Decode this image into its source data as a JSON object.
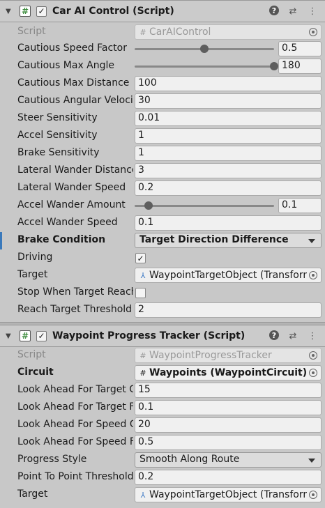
{
  "car_ai": {
    "title": "Car AI Control (Script)",
    "script_label": "Script",
    "script_value": "CarAIControl",
    "rows": [
      {
        "label": "Cautious Speed Factor",
        "value": "0.5",
        "slider": 0.5
      },
      {
        "label": "Cautious Max Angle",
        "value": "180",
        "slider": 1.0
      },
      {
        "label": "Cautious Max Distance",
        "value": "100"
      },
      {
        "label": "Cautious Angular Velocity Factor",
        "value": "30"
      },
      {
        "label": "Steer Sensitivity",
        "value": "0.01"
      },
      {
        "label": "Accel Sensitivity",
        "value": "1"
      },
      {
        "label": "Brake Sensitivity",
        "value": "1"
      },
      {
        "label": "Lateral Wander Distance",
        "value": "3"
      },
      {
        "label": "Lateral Wander Speed",
        "value": "0.2"
      },
      {
        "label": "Accel Wander Amount",
        "value": "0.1",
        "slider": 0.1
      },
      {
        "label": "Accel Wander Speed",
        "value": "0.1"
      }
    ],
    "brake_condition": {
      "label": "Brake Condition",
      "value": "Target Direction Difference"
    },
    "driving": {
      "label": "Driving",
      "checked": true
    },
    "target": {
      "label": "Target",
      "value": "WaypointTargetObject (Transform)"
    },
    "stop_when_target_reached": {
      "label": "Stop When Target Reached",
      "checked": false
    },
    "reach_target_threshold": {
      "label": "Reach Target Threshold",
      "value": "2"
    }
  },
  "waypoint_tracker": {
    "title": "Waypoint Progress Tracker (Script)",
    "script_label": "Script",
    "script_value": "WaypointProgressTracker",
    "circuit": {
      "label": "Circuit",
      "value": "Waypoints (WaypointCircuit)"
    },
    "rows": [
      {
        "label": "Look Ahead For Target Offset",
        "value": "15"
      },
      {
        "label": "Look Ahead For Target Factor",
        "value": "0.1"
      },
      {
        "label": "Look Ahead For Speed Offset",
        "value": "20"
      },
      {
        "label": "Look Ahead For Speed Factor",
        "value": "0.5"
      }
    ],
    "progress_style": {
      "label": "Progress Style",
      "value": "Smooth Along Route"
    },
    "point_threshold": {
      "label": "Point To Point Threshold",
      "value": "0.2"
    },
    "target": {
      "label": "Target",
      "value": "WaypointTargetObject (Transform)"
    }
  },
  "icons": {
    "help": "?",
    "presets": "⇄",
    "menu": "⋮",
    "foldout": "▼",
    "check": "✓",
    "script": "#",
    "transform": "⅄"
  },
  "colors": {
    "marker": "#3a79bb",
    "script_icon": "#3a8a3a"
  }
}
